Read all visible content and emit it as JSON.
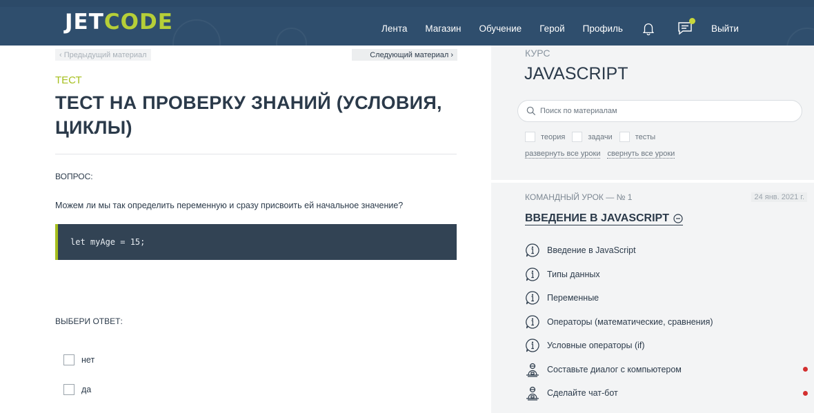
{
  "header": {
    "logo_part1": "JET",
    "logo_part2": "CODE",
    "nav": [
      "Лента",
      "Магазин",
      "Обучение",
      "Герой",
      "Профиль"
    ],
    "logout": "Выйти",
    "bg_color": "#2f4e6d",
    "accent_color": "#b6cf38"
  },
  "material_nav": {
    "prev": "‹ Предыдущий материал",
    "next": "Следующий материал ›"
  },
  "content": {
    "tag": "ТЕСТ",
    "title": "ТЕСТ НА ПРОВЕРКУ ЗНАНИЙ (УСЛОВИЯ, ЦИКЛЫ)",
    "question_label": "ВОПРОС:",
    "question": "Можем ли мы так определить переменную и сразу присвоить ей начальное значение?",
    "code": "let myAge = 15;",
    "answer_label": "ВЫБЕРИ ОТВЕТ:",
    "answers": [
      {
        "label": "нет",
        "checked": false
      },
      {
        "label": "да",
        "checked": false
      }
    ]
  },
  "sidebar": {
    "kicker": "КУРС",
    "course": "JAVASCRIPT",
    "search_placeholder": "Поиск по материалам",
    "filters": [
      "теория",
      "задачи",
      "тесты"
    ],
    "expand_all": "развернуть все уроки",
    "collapse_all": "свернуть все уроки",
    "lesson": {
      "kicker": "КОМАНДНЫЙ УРОК — № 1",
      "date": "24 янв. 2021 г.",
      "title": "ВВЕДЕНИЕ В JAVASCRIPT",
      "items": [
        {
          "icon": "info-bubble-icon",
          "label": "Введение в JavaScript",
          "dot": false
        },
        {
          "icon": "info-bubble-icon",
          "label": "Типы данных",
          "dot": false
        },
        {
          "icon": "info-bubble-icon",
          "label": "Переменные",
          "dot": false
        },
        {
          "icon": "info-bubble-icon",
          "label": "Операторы (математические, сравнения)",
          "dot": false
        },
        {
          "icon": "info-bubble-icon",
          "label": "Условные операторы (if)",
          "dot": false
        },
        {
          "icon": "task-person-icon",
          "label": "Составьте диалог с компьютером",
          "dot": true
        },
        {
          "icon": "task-person-icon",
          "label": "Сделайте чат-бот",
          "dot": true
        }
      ]
    }
  }
}
